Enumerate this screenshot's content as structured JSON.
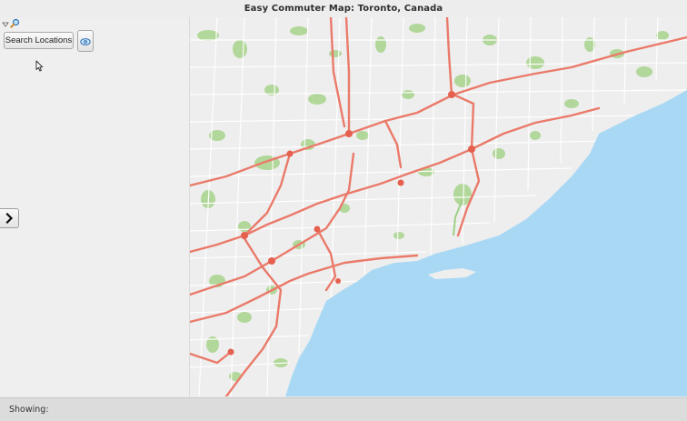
{
  "window": {
    "title": "Easy Commuter Map: Toronto, Canada"
  },
  "toolbar": {
    "collapse_icon": "triangle-down-icon",
    "search_icon": "magnifier-icon"
  },
  "sidebar": {
    "search_button_label": "Search Locations",
    "view_button_icon": "eye-icon",
    "expand_button_icon": "chevron-right-icon"
  },
  "map": {
    "city": "Toronto",
    "colors": {
      "water": "#a9d8f5",
      "land": "#eeeeee",
      "park": "#a8d48c",
      "highway": "#ea7a6a",
      "street": "#ffffff"
    }
  },
  "statusbar": {
    "showing_label": "Showing:"
  }
}
